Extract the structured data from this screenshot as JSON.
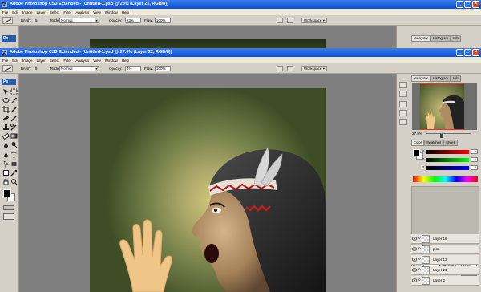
{
  "back_window": {
    "title": "Adobe Photoshop CS3 Extended - [Untitled-1.psd @ 28% (Layer 21, RGB/8)]",
    "menu": [
      "File",
      "Edit",
      "Image",
      "Layer",
      "Select",
      "Filter",
      "Analysis",
      "View",
      "Window",
      "Help"
    ],
    "options": {
      "brush_label": "Brush:",
      "brush_size": "5",
      "mode_label": "Mode:",
      "mode_value": "Normal",
      "opacity_label": "Opacity:",
      "opacity_value": "23%",
      "flow_label": "Flow:",
      "flow_value": "100%"
    },
    "workspace_label": "Workspace",
    "dock_tabs": [
      "Navigator",
      "Histogram",
      "Info"
    ]
  },
  "front_window": {
    "title": "Adobe Photoshop CS3 Extended - [Untitled-1.psd @ 27.9% (Layer 22, RGB/8)]",
    "menu": [
      "File",
      "Edit",
      "Image",
      "Layer",
      "Select",
      "Filter",
      "Analysis",
      "View",
      "Window",
      "Help"
    ],
    "options": {
      "brush_label": "Brush:",
      "brush_size": "9",
      "mode_label": "Mode:",
      "mode_value": "Normal",
      "opacity_label": "Opacity:",
      "opacity_value": "4%",
      "flow_label": "Flow:",
      "flow_value": "100%"
    },
    "workspace_label": "Workspace",
    "toolbox_logo": "Ps",
    "navigator": {
      "tabs": [
        "Navigator",
        "Histogram",
        "Info"
      ],
      "zoom": "27.9%"
    },
    "color_panel": {
      "tabs": [
        "Color",
        "Swatches",
        "Styles"
      ],
      "channels": [
        {
          "label": "R",
          "value": "0"
        },
        {
          "label": "G",
          "value": "0"
        },
        {
          "label": "B",
          "value": "0"
        }
      ]
    },
    "layers_panel": {
      "tabs": [
        "Layers",
        "Channels",
        "Paths"
      ],
      "blend_mode": "Normal",
      "opacity_label": "Opacity:",
      "opacity_value": "100%",
      "lock_label": "Lock:",
      "fill_label": "Fill:",
      "fill_value": "100%",
      "layers": [
        "Layer 18",
        "pka",
        "Layer 13",
        "Layer 20",
        "Layer 2"
      ]
    }
  },
  "colors": {
    "title_bar": "#0b4fd8",
    "chrome": "#d4d0c8",
    "workspace_bg": "#7f7f7f",
    "foreground": "#000000",
    "background": "#ffffff"
  }
}
